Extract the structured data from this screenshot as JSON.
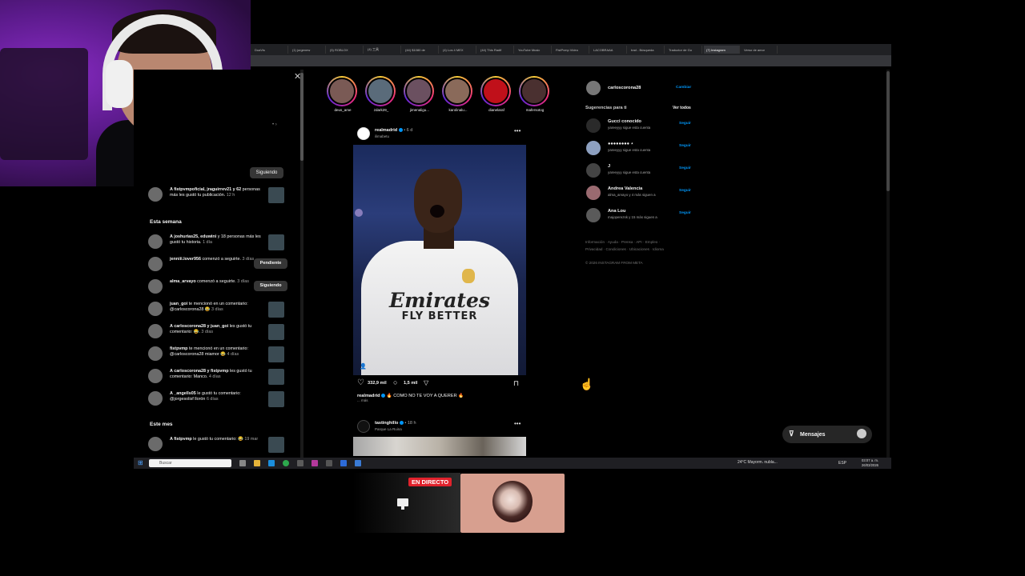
{
  "browser": {
    "tabs": [
      "DuaVis",
      "(1) jorgenew",
      "(5) ROBLOX",
      "(4) 工具",
      "(44) $1080 de",
      "(4) Los 4 MEX",
      "(44) This Radif",
      "YouTube Music",
      "FistPvmp Video",
      "LACOBRAAA",
      "trad - Búsqueda",
      "Traductor de Go",
      "(7) Instagram",
      "Verso de amor"
    ],
    "active_tab_index": 12
  },
  "notifications": {
    "following_btn_top": "Siguiendo",
    "first": {
      "users": "A fistpvmpoficial, jraguirrev21 y 62",
      "text": " personas más les gustó tu publicación.",
      "time": "12 h"
    },
    "sections": {
      "week": "Esta semana",
      "month": "Este mes"
    },
    "week_items": [
      {
        "users": "A joshurias25, eduwini",
        "text": " y 18 personas más les gustó tu historia.",
        "time": "1 día"
      },
      {
        "users": "jenniii.lover956",
        "text": " comenzó a seguirte.",
        "time": "3 días",
        "button": "Pendiente"
      },
      {
        "users": "alma_arvayo",
        "text": " comenzó a seguirte.",
        "time": "3 días",
        "button": "Siguiendo"
      },
      {
        "users": "juan_goi",
        "text": " te mencionó en un comentario: @carloscorona28 😂",
        "time": "3 días"
      },
      {
        "users": "A carloscorona28 y juan_goi",
        "text": " les gustó tu comentario: 😂.",
        "time": "3 días"
      },
      {
        "users": "fistpvmp",
        "text": " te mencionó en un comentario: @carloscorona28 miamor 😂",
        "time": "4 días"
      },
      {
        "users": "A carloscorona28 y fistpvmp",
        "text": " les gustó tu comentario: Manco.",
        "time": "4 días"
      },
      {
        "users": "A _angells05",
        "text": " le gustó tu comentario: @jorgesolisf llorón",
        "time": "6 días"
      }
    ],
    "month_items": [
      {
        "users": "A fistpvmp",
        "text": " le gustó tu comentario: 😂",
        "time": "19 mar"
      }
    ]
  },
  "stories": [
    "deus_ame",
    "zdark29_",
    "jimenaligu...",
    "karolinalu...",
    "dianelaraf",
    "mafersotog"
  ],
  "post": {
    "user": "realmadrid",
    "time": "• 6 d",
    "sub": "ilimabetu",
    "likes": "332,9 mil",
    "comments": "1,5 mil",
    "caption_user": "realmadrid",
    "caption_text": " 🔥 COMO NO TE VOY A QUERER 🔥",
    "caption_more": "... más",
    "sponsor_line1": "Emirates",
    "sponsor_line2": "FLY BETTER"
  },
  "post2": {
    "user": "tastinghillo",
    "time": "• 18 h",
    "sub": "Parque La Ruina"
  },
  "right": {
    "me": "carloscorona28",
    "switch": "Cambiar",
    "suggestions_title": "Sugerencias para ti",
    "see_all": "Ver todos",
    "follow_label": "Seguir",
    "suggestions": [
      {
        "name": "Gucci conocido",
        "sub": "yareeyyy sigue esta cuenta"
      },
      {
        "name": "●●●●●●●● ⋆",
        "sub": "yareeyyy sigue esta cuenta"
      },
      {
        "name": "J",
        "sub": "yareeyyy sigue esta cuenta"
      },
      {
        "name": "Andrea Valencia",
        "sub": "alma_arvayo y 4 más siguen a"
      },
      {
        "name": "Ana Lou",
        "sub": "majoperezsk y 15 más siguen a"
      }
    ],
    "footer_line1": "Información · Ayuda · Prensa · API · Empleo ·",
    "footer_line2": "Privacidad · Condiciones · Ubicaciones · Idioma",
    "footer_copy": "© 2026 INSTAGRAM FROM META"
  },
  "messages_label": "Mensajes",
  "taskbar": {
    "search": "Buscar",
    "weather": "24°C  Mayorm. nubla...",
    "lang": "ESP",
    "time": "03:07 a. m.",
    "date": "26/03/2026"
  },
  "stream": {
    "live_badge": "EN DIRECTO"
  },
  "colors": {
    "accent": "#0095f6",
    "live": "#e0222c",
    "bg": "#000000"
  }
}
